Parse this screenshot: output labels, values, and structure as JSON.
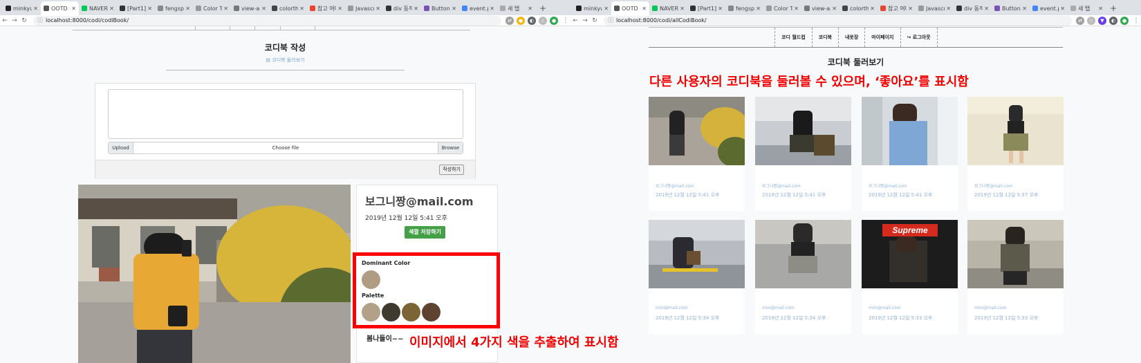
{
  "left_window": {
    "tabs": [
      {
        "title": "minkyun",
        "color": "#222222",
        "active": false
      },
      {
        "title": "OOTD - C",
        "color": "#555555",
        "active": true
      },
      {
        "title": "NAVER",
        "color": "#03c75a",
        "active": false
      },
      {
        "title": "[Part1] J",
        "color": "#333333",
        "active": false
      },
      {
        "title": "fengsp",
        "color": "#888888",
        "active": false
      },
      {
        "title": "Color Th",
        "color": "#999999",
        "active": false
      },
      {
        "title": "view-as",
        "color": "#777777",
        "active": false
      },
      {
        "title": "colorthi",
        "color": "#444444",
        "active": false
      },
      {
        "title": "참고 여다",
        "color": "#e8452c",
        "active": false
      },
      {
        "title": "Javascri",
        "color": "#999999",
        "active": false
      },
      {
        "title": "div 동적",
        "color": "#333333",
        "active": false
      },
      {
        "title": "Buttons",
        "color": "#7952b3",
        "active": false
      },
      {
        "title": "event.p",
        "color": "#4285f4",
        "active": false
      },
      {
        "title": "새 탭",
        "color": "#aaaaaa",
        "active": false
      }
    ],
    "url": "localhost:8000/codi/codiBook/",
    "page_title": "코디북 작성",
    "browse_link": "코디북 둘러보기",
    "upload_label": "Upload",
    "choose_file": "Choose file",
    "browse_label": "Browse",
    "submit_label": "작성하기",
    "email": "보그니짱@mail.com",
    "date": "2019년 12월 12일 5:41 오후",
    "save_color_label": "색깔 저장하기",
    "dominant_label": "Dominant Color",
    "dominant_color": "#b09c83",
    "palette_label": "Palette",
    "palette": [
      "#b3a089",
      "#3f3a30",
      "#7b6534",
      "#5e4430"
    ],
    "comment": "봄나들이~~",
    "annotation": "이미지에서 4가지 색을 추출하여 표시함"
  },
  "right_window": {
    "tabs": [
      {
        "title": "minkyun",
        "color": "#222222",
        "active": false
      },
      {
        "title": "OOTD - C",
        "color": "#555555",
        "active": true
      },
      {
        "title": "NAVER",
        "color": "#03c75a",
        "active": false
      },
      {
        "title": "[Part1] J",
        "color": "#333333",
        "active": false
      },
      {
        "title": "fengsp",
        "color": "#888888",
        "active": false
      },
      {
        "title": "Color Th",
        "color": "#999999",
        "active": false
      },
      {
        "title": "view-as",
        "color": "#777777",
        "active": false
      },
      {
        "title": "colorthi",
        "color": "#444444",
        "active": false
      },
      {
        "title": "참고 여다",
        "color": "#e8452c",
        "active": false
      },
      {
        "title": "Javascri",
        "color": "#999999",
        "active": false
      },
      {
        "title": "div 동적",
        "color": "#333333",
        "active": false
      },
      {
        "title": "Buttons",
        "color": "#7952b3",
        "active": false
      },
      {
        "title": "event.p",
        "color": "#4285f4",
        "active": false
      },
      {
        "title": "새 탭",
        "color": "#aaaaaa",
        "active": false
      }
    ],
    "url": "localhost:8000/codi/allCodiBook/",
    "nav": [
      "코디 월드컵",
      "코디북",
      "내옷장",
      "마이페이지",
      "↪ 로그아웃"
    ],
    "page_title": "코디북 둘러보기",
    "annotation": "다른 사용자의 코디북을 둘러볼 수 있으며, ‘좋아요’를 표시함",
    "cards": [
      {
        "email": "보그니짱@mail.com",
        "date": "2019년 12월 12일 5:41 오후"
      },
      {
        "email": "보그니짱@mail.com",
        "date": "2019년 12월 12일 5:41 오후"
      },
      {
        "email": "보그니짱@mail.com",
        "date": "2019년 12월 12일 5:41 오후"
      },
      {
        "email": "보그니짱@mail.com",
        "date": "2019년 12월 12일 5:37 오후"
      },
      {
        "email": "mini@mail.com",
        "date": "2019년 12월 12일 5:34 오후"
      },
      {
        "email": "mini@mail.com",
        "date": "2019년 12월 12일 5:34 오후"
      },
      {
        "email": "mini@mail.com",
        "date": "2019년 12월 12일 5:33 오후"
      },
      {
        "email": "mini@mail.com",
        "date": "2019년 12월 12일 5:33 오후"
      }
    ],
    "supreme_text": "Supreme"
  }
}
